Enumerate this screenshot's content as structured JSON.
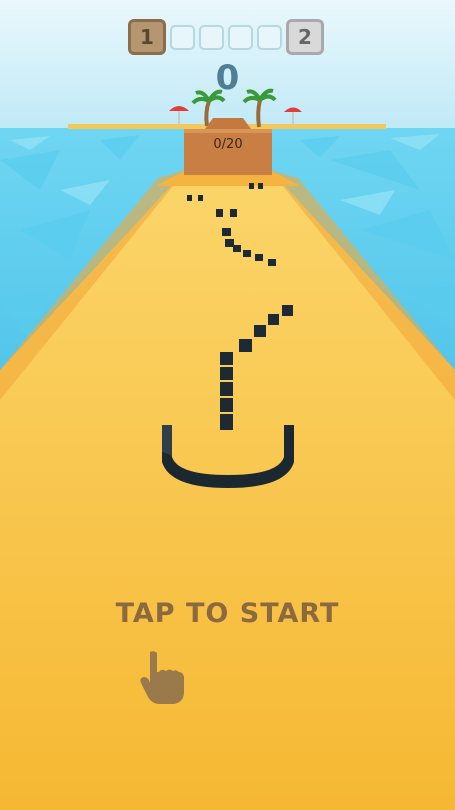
{
  "hud": {
    "current_level": "1",
    "next_level": "2",
    "progress_steps": 4,
    "score": "0"
  },
  "collector": {
    "counter_text": "0/20"
  },
  "prompt": {
    "tap_to_start": "TAP TO START"
  },
  "icons": {
    "hand": "pointing-hand-icon"
  },
  "colors": {
    "track": "#f7c63f",
    "water": "#35c0ea",
    "sky": "#7fd3ef",
    "blocks": "#1d2a33",
    "text": "#8a6a3e"
  }
}
